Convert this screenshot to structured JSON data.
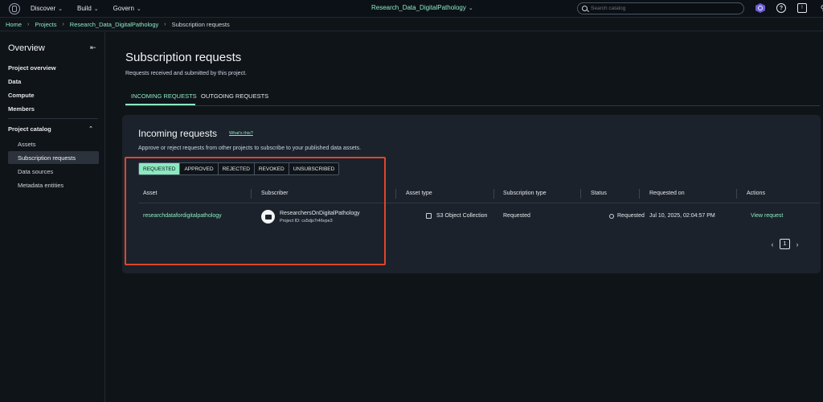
{
  "topnav": {
    "menu": [
      {
        "label": "Discover"
      },
      {
        "label": "Build"
      },
      {
        "label": "Govern"
      }
    ],
    "project": "Research_Data_DigitalPathology",
    "search_placeholder": "Search catalog"
  },
  "breadcrumb": {
    "home": "Home",
    "projects": "Projects",
    "project": "Research_Data_DigitalPathology",
    "current": "Subscription requests"
  },
  "sidebar": {
    "title": "Overview",
    "items": [
      "Project overview",
      "Data",
      "Compute",
      "Members"
    ],
    "section": "Project catalog",
    "subitems": [
      "Assets",
      "Subscription requests",
      "Data sources",
      "Metadata entities"
    ]
  },
  "page": {
    "title": "Subscription requests",
    "description": "Requests received and submitted by this project.",
    "tabs": [
      "INCOMING REQUESTS",
      "OUTGOING REQUESTS"
    ]
  },
  "card": {
    "title": "Incoming requests",
    "whats_this": "What's this?",
    "description": "Approve or reject requests from other projects to subscribe to your published data assets.",
    "filters": [
      "REQUESTED",
      "APPROVED",
      "REJECTED",
      "REVOKED",
      "UNSUBSCRIBED"
    ],
    "columns": [
      "Asset",
      "Subscriber",
      "Asset type",
      "Subscription type",
      "Status",
      "Requested on",
      "Actions"
    ],
    "rows": [
      {
        "asset": "researchdatafordigitalpathology",
        "subscriber_name": "ResearchersOnDigitalPathology",
        "subscriber_id": "Project ID: cs5djs7r46vpe3",
        "asset_type": "S3 Object Collection",
        "subscription_type": "Requested",
        "status": "Requested",
        "requested_on": "Jul 10, 2025, 02:04:57 PM",
        "action": "View request"
      }
    ],
    "pagination": {
      "page": "1"
    }
  },
  "colors": {
    "accent": "#8be9c0",
    "highlight": "#e0452b",
    "background": "#0f1419",
    "card": "#1b222b"
  }
}
